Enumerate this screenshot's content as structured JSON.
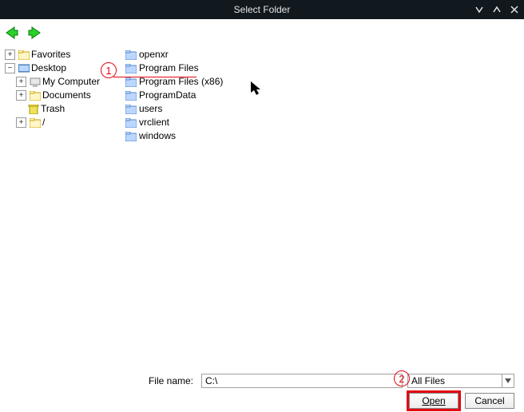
{
  "titlebar": {
    "title": "Select Folder"
  },
  "tree": {
    "favorites_label": "Favorites",
    "desktop_label": "Desktop",
    "my_computer_label": "My Computer",
    "documents_label": "Documents",
    "trash_label": "Trash",
    "slash_label": "/"
  },
  "list": {
    "items": [
      "openxr",
      "Program Files",
      "Program Files (x86)",
      "ProgramData",
      "users",
      "vrclient",
      "windows"
    ]
  },
  "footer": {
    "filename_label": "File name:",
    "filename_value": "C:\\",
    "filter_label": "All Files",
    "open_label": "Open",
    "cancel_label": "Cancel"
  },
  "annotations": {
    "step1": "1",
    "step2": "2"
  }
}
